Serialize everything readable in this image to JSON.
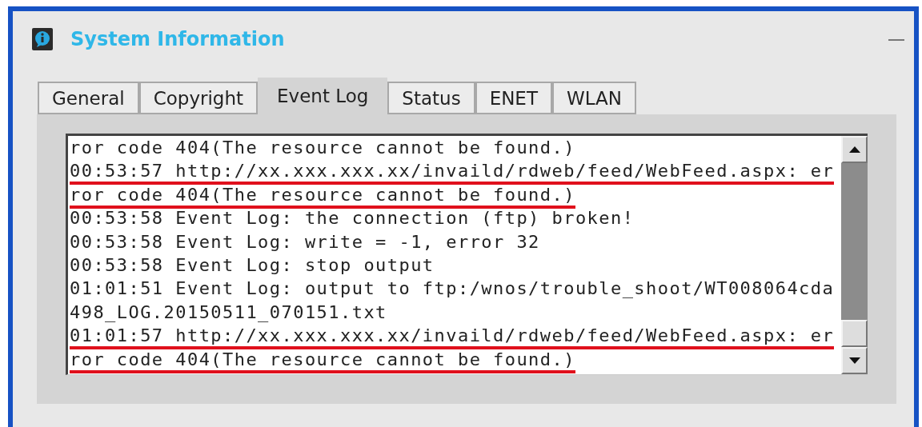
{
  "window": {
    "title": "System Information"
  },
  "tabs": [
    {
      "label": "General",
      "selected": false
    },
    {
      "label": "Copyright",
      "selected": false
    },
    {
      "label": "Event Log",
      "selected": true
    },
    {
      "label": "Status",
      "selected": false
    },
    {
      "label": "ENET",
      "selected": false
    },
    {
      "label": "WLAN",
      "selected": false
    }
  ],
  "log_lines": [
    {
      "text": "ror code 404(The resource cannot be found.)",
      "highlighted": false
    },
    {
      "text": "00:53:57 http://xx.xxx.xxx.xx/invaild/rdweb/feed/WebFeed.aspx: er",
      "highlighted": true
    },
    {
      "text": "ror code 404(The resource cannot be found.)",
      "highlighted": true
    },
    {
      "text": "00:53:58 Event Log: the connection (ftp) broken!",
      "highlighted": false
    },
    {
      "text": "00:53:58 Event Log: write = -1, error 32",
      "highlighted": false
    },
    {
      "text": "00:53:58 Event Log: stop output",
      "highlighted": false
    },
    {
      "text": "01:01:51 Event Log: output to ftp:/wnos/trouble_shoot/WT008064cda",
      "highlighted": false
    },
    {
      "text": "498_LOG.20150511_070151.txt",
      "highlighted": false
    },
    {
      "text": "01:01:57 http://xx.xxx.xxx.xx/invaild/rdweb/feed/WebFeed.aspx: er",
      "highlighted": true
    },
    {
      "text": "ror code 404(The resource cannot be found.)",
      "highlighted": true
    }
  ]
}
